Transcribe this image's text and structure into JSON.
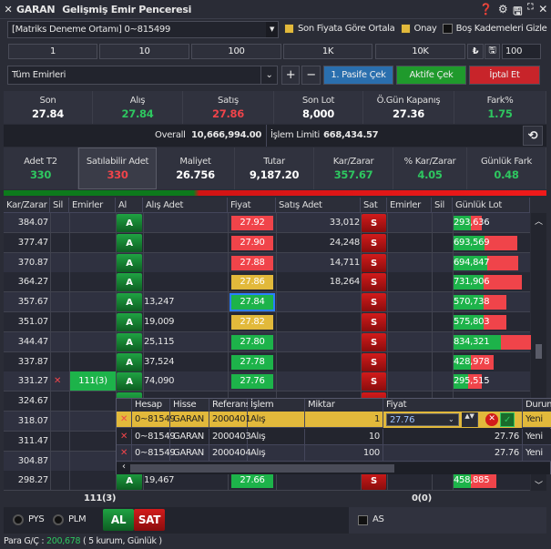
{
  "window": {
    "symbol": "GARAN",
    "title": "Gelişmiş Emir Penceresi"
  },
  "account": {
    "value": "[Matriks Deneme Ortamı] 0~815499"
  },
  "options": {
    "center_label": "Son Fiyata Göre Ortala",
    "center_checked": true,
    "confirm_label": "Onay",
    "confirm_checked": true,
    "hide_label": "Boş Kademeleri Gizle",
    "hide_checked": false
  },
  "quantities": [
    "1",
    "10",
    "100",
    "1K",
    "10K"
  ],
  "qty_input": "100",
  "orders_filter": "Tüm Emirleri",
  "actions": {
    "plus": "+",
    "minus": "−",
    "passive": "1. Pasife Çek",
    "active": "Aktife Çek",
    "cancel": "İptal Et"
  },
  "stats": [
    {
      "label": "Son",
      "value": "27.84",
      "color": "#ffffff"
    },
    {
      "label": "Alış",
      "value": "27.84",
      "color": "#2ec760"
    },
    {
      "label": "Satış",
      "value": "27.86",
      "color": "#f0444a"
    },
    {
      "label": "Son Lot",
      "value": "8,000",
      "color": "#ffffff"
    },
    {
      "label": "Ö.Gün Kapanış",
      "value": "27.36",
      "color": "#ffffff"
    },
    {
      "label": "Fark%",
      "value": "1.75",
      "color": "#2ec760"
    }
  ],
  "overall": {
    "label": "Overall",
    "value": "10,666,994.00",
    "limit_label": "İşlem Limiti",
    "limit_value": "668,434.57"
  },
  "position": [
    {
      "label": "Adet T2",
      "value": "330",
      "color": "#2ec760"
    },
    {
      "label": "Satılabilir Adet",
      "value": "330",
      "color": "#f0444a"
    },
    {
      "label": "Maliyet",
      "value": "26.756",
      "color": "#ffffff"
    },
    {
      "label": "Tutar",
      "value": "9,187.20",
      "color": "#ffffff"
    },
    {
      "label": "Kar/Zarar",
      "value": "357.67",
      "color": "#2ec760"
    },
    {
      "label": "% Kar/Zarar",
      "value": "4.05",
      "color": "#2ec760"
    },
    {
      "label": "Günlük Fark",
      "value": "0.48",
      "color": "#2ec760"
    }
  ],
  "table": {
    "headers": [
      "Kar/Zarar",
      "Sil",
      "Emirler",
      "Al",
      "Alış Adet",
      "Fiyat",
      "Satış Adet",
      "Sat",
      "Emirler",
      "Sil",
      "Günlük Lot"
    ],
    "buy_label": "A",
    "sell_label": "S",
    "rows": [
      {
        "pl": "384.07",
        "price": "27.92",
        "pc": "#f0444a",
        "sell": "33,012",
        "lot": "293,636",
        "lg": 0.22,
        "lr": 0.14
      },
      {
        "pl": "377.47",
        "price": "27.90",
        "pc": "#f0444a",
        "sell": "24,248",
        "lot": "693,569",
        "lg": 0.4,
        "lr": 0.42
      },
      {
        "pl": "370.87",
        "price": "27.88",
        "pc": "#f0444a",
        "sell": "14,711",
        "lot": "694,847",
        "lg": 0.44,
        "lr": 0.39
      },
      {
        "pl": "364.27",
        "price": "27.86",
        "pc": "#e2b93b",
        "sell": "18,264",
        "lot": "731,906",
        "lg": 0.39,
        "lr": 0.49
      },
      {
        "pl": "357.67",
        "price": "27.84",
        "pc": "#1db34a",
        "buy": "13,247",
        "lot": "570,738",
        "lg": 0.39,
        "lr": 0.29,
        "selected": true
      },
      {
        "pl": "351.07",
        "price": "27.82",
        "pc": "#e2b93b",
        "buy": "19,009",
        "lot": "575,803",
        "lg": 0.39,
        "lr": 0.29
      },
      {
        "pl": "344.47",
        "price": "27.80",
        "pc": "#1db34a",
        "buy": "25,115",
        "lot": "834,321",
        "lg": 0.61,
        "lr": 0.39
      },
      {
        "pl": "337.87",
        "price": "27.78",
        "pc": "#1db34a",
        "buy": "37,524",
        "lot": "428,978",
        "lg": 0.22,
        "lr": 0.3
      },
      {
        "pl": "331.27",
        "price": "27.76",
        "pc": "#1db34a",
        "buy": "74,090",
        "lot": "295,515",
        "lg": 0.19,
        "lr": 0.18,
        "orders": "111(3)",
        "del": "✕"
      },
      {
        "pl": "324.67"
      },
      {
        "pl": "318.07"
      },
      {
        "pl": "311.47"
      },
      {
        "pl": "304.87"
      },
      {
        "pl": "298.27",
        "price": "27.66",
        "pc": "#1db34a",
        "buy": "19,467",
        "lot": "458,885",
        "lg": 0.22,
        "lr": 0.33
      }
    ]
  },
  "popup": {
    "headers": [
      "Hesap",
      "Hisse",
      "Referans",
      "İşlem",
      "Miktar",
      "Fiyat",
      "Durum"
    ],
    "rows": [
      {
        "account": "0~81549",
        "symbol": "GARAN",
        "ref": "2000401",
        "side": "Alış",
        "qty": "1",
        "price": "27.76",
        "status": "Yeni",
        "editing": true
      },
      {
        "account": "0~81549",
        "symbol": "GARAN",
        "ref": "2000403",
        "side": "Alış",
        "qty": "10",
        "price": "27.76",
        "status": "Yeni"
      },
      {
        "account": "0~81549",
        "symbol": "GARAN",
        "ref": "2000404",
        "side": "Alış",
        "qty": "100",
        "price": "27.76",
        "status": "Yeni"
      }
    ]
  },
  "totals": {
    "buy": "111(3)",
    "sell": "0(0)"
  },
  "bottom": {
    "pys": "PYS",
    "plm": "PLM",
    "al": "AL",
    "sat": "SAT",
    "as": "AS"
  },
  "status": {
    "label": "Para G/Ç :",
    "value": "200,678",
    "detail": "( 5 kurum, Günlük )"
  }
}
